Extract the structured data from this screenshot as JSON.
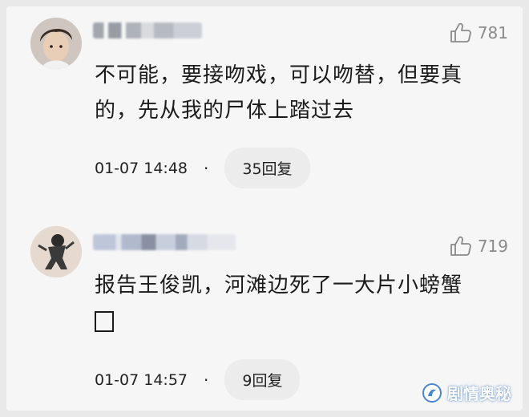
{
  "comments": [
    {
      "likes": "781",
      "text_lines": [
        "不可能，要接吻戏，可以吻替，但要真",
        "的，先从我的尸体上踏过去"
      ],
      "time": "01-07 14:48",
      "separator": "·",
      "reply_label": "35回复"
    },
    {
      "likes": "719",
      "text_lines": [
        "报告王俊凯，河滩边死了一大片小螃蟹"
      ],
      "time": "01-07 14:57",
      "separator": "·",
      "reply_label": "9回复"
    }
  ],
  "watermark": {
    "text": "剧情奥秘"
  },
  "colors": {
    "background": "#f6f6f6",
    "like": "#8a8a8a",
    "reply_button": "#ececec"
  },
  "icons": {
    "like": "thumbs-up-outline-icon",
    "watermark": "wave-logo-icon"
  }
}
